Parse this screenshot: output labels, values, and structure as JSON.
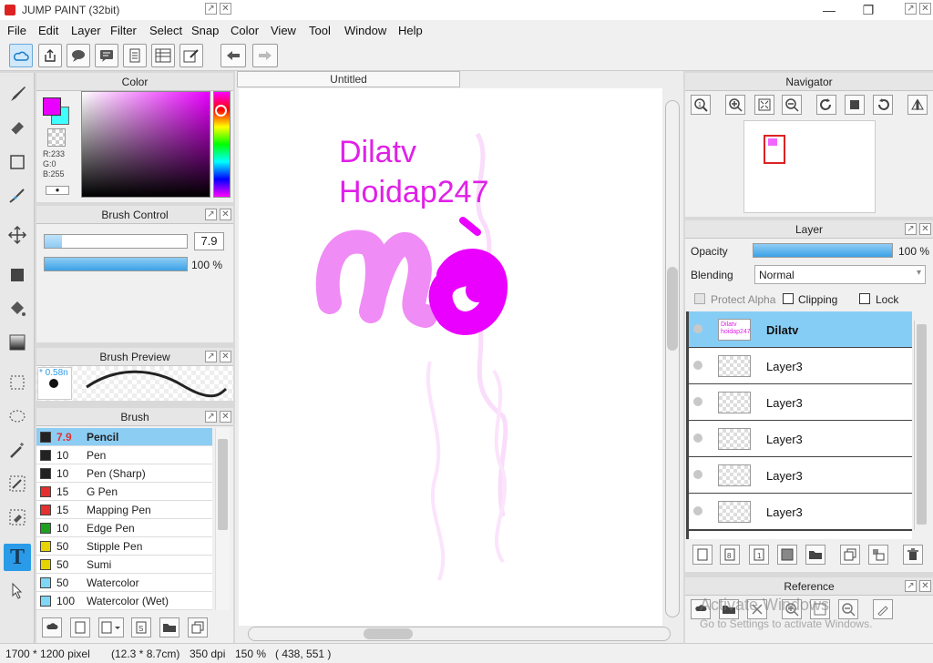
{
  "window": {
    "title": "JUMP PAINT (32bit)",
    "minimize": "—",
    "maximize": "❐",
    "close": "✕"
  },
  "menu": [
    "File",
    "Edit",
    "Layer",
    "Filter",
    "Select",
    "Snap",
    "Color",
    "View",
    "Tool",
    "Window",
    "Help"
  ],
  "toolbar": {
    "icons": [
      "cloud-icon",
      "share-icon",
      "speech-bubble-icon",
      "comment-icon",
      "page-icon",
      "grid-icon",
      "edit-icon",
      "undo-icon",
      "redo-icon"
    ]
  },
  "panels": {
    "color": {
      "title": "Color",
      "main_color": "#e900ff",
      "sub_color": "#40ffff",
      "r": "R:233",
      "g": "G:0",
      "b": "B:255"
    },
    "brush_control": {
      "title": "Brush Control",
      "size": "7.9",
      "size_fraction": 0.12,
      "opacity": "100 %",
      "opacity_fraction": 1.0
    },
    "brush_preview": {
      "title": "Brush Preview",
      "size_label": "* 0.58n"
    },
    "brush": {
      "title": "Brush",
      "items": [
        {
          "size": "7.9",
          "name": "Pencil",
          "color": "#222222"
        },
        {
          "size": "10",
          "name": "Pen",
          "color": "#222222"
        },
        {
          "size": "10",
          "name": "Pen (Sharp)",
          "color": "#222222"
        },
        {
          "size": "15",
          "name": "G Pen",
          "color": "#e53030"
        },
        {
          "size": "15",
          "name": "Mapping Pen",
          "color": "#e53030"
        },
        {
          "size": "10",
          "name": "Edge Pen",
          "color": "#20a020"
        },
        {
          "size": "50",
          "name": "Stipple Pen",
          "color": "#e6d400"
        },
        {
          "size": "50",
          "name": "Sumi",
          "color": "#e6d400"
        },
        {
          "size": "50",
          "name": "Watercolor",
          "color": "#7fd6f5"
        },
        {
          "size": "100",
          "name": "Watercolor (Wet)",
          "color": "#7fd6f5"
        }
      ]
    },
    "navigator": {
      "title": "Navigator"
    },
    "layer": {
      "title": "Layer",
      "opacity_label": "Opacity",
      "opacity_value": "100 %",
      "opacity_fraction": 1.0,
      "blending_label": "Blending",
      "blending_value": "Normal",
      "protect_alpha": "Protect Alpha",
      "clipping": "Clipping",
      "lock": "Lock",
      "items": [
        {
          "name": "Dilatv",
          "thumb": "Dilatv hoidap247"
        },
        {
          "name": "Layer3",
          "thumb": ""
        },
        {
          "name": "Layer3",
          "thumb": ""
        },
        {
          "name": "Layer3",
          "thumb": ""
        },
        {
          "name": "Layer3",
          "thumb": ""
        },
        {
          "name": "Layer3",
          "thumb": ""
        }
      ]
    },
    "reference": {
      "title": "Reference"
    }
  },
  "document": {
    "tab": "Untitled",
    "text_line1": "Dilatv",
    "text_line2": "Hoidap247",
    "brush_color": "#e900ff",
    "brush_color_light": "#f08cf5"
  },
  "watermark": {
    "line1": "Activate Windows",
    "line2": "Go to Settings to activate Windows."
  },
  "status": {
    "size": "1700 * 1200 pixel",
    "cm": "(12.3 * 8.7cm)",
    "dpi": "350 dpi",
    "zoom": "150 %",
    "coords": "( 438, 551 )"
  }
}
